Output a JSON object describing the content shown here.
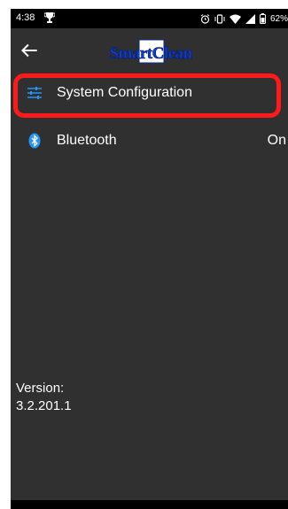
{
  "status_bar": {
    "time": "4:38",
    "battery": "62%"
  },
  "app": {
    "logo_text": "SmartClean"
  },
  "menu": {
    "items": [
      {
        "label": "System Configuration",
        "value": ""
      },
      {
        "label": "Bluetooth",
        "value": "On"
      }
    ]
  },
  "version": {
    "label": "Version:",
    "value": "3.2.201.1"
  },
  "colors": {
    "background": "#303030",
    "accent_icon": "#2196f3",
    "highlight": "#ff1a1a"
  },
  "icons": {
    "back": "arrow-left-icon",
    "system": "sliders-icon",
    "bluetooth": "bluetooth-icon"
  }
}
